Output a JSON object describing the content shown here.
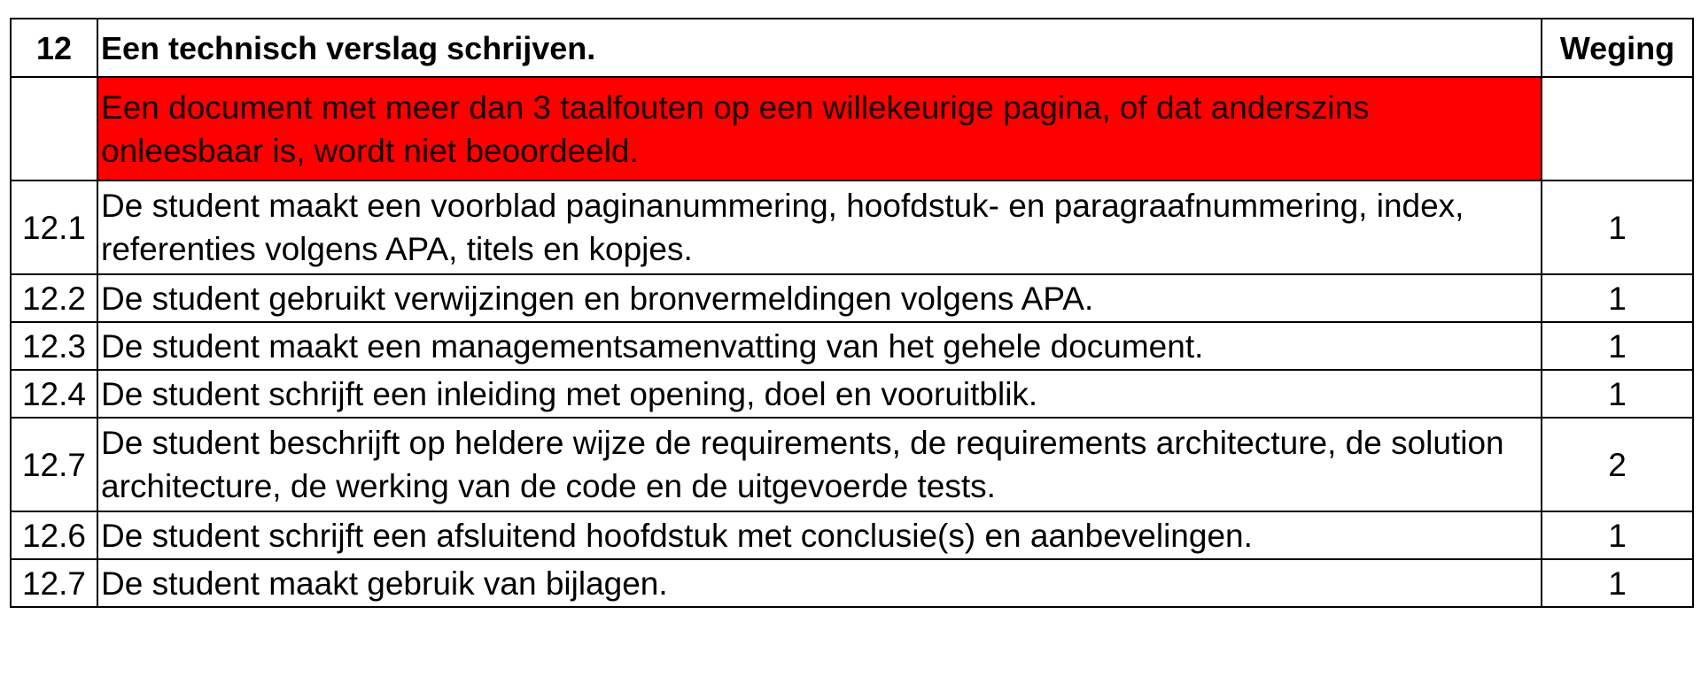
{
  "header": {
    "number": "12",
    "title": "Een technisch verslag schrijven.",
    "weight_label": "Weging"
  },
  "warning": {
    "text": "Een document met meer dan 3 taalfouten op een willekeurige pagina, of dat anderszins onleesbaar is, wordt niet beoordeeld.",
    "color": "#ff0000"
  },
  "rows": [
    {
      "number": "12.1",
      "text": "De student maakt een voorblad paginanummering, hoofdstuk- en paragraafnummering, index, referenties volgens APA, titels en kopjes.",
      "weight": "1"
    },
    {
      "number": "12.2",
      "text": "De student gebruikt verwijzingen en bronvermeldingen volgens APA.",
      "weight": "1"
    },
    {
      "number": "12.3",
      "text": "De student maakt een managementsamenvatting van het gehele document.",
      "weight": "1"
    },
    {
      "number": "12.4",
      "text": "De student schrijft een inleiding met opening, doel en vooruitblik.",
      "weight": "1"
    },
    {
      "number": "12.7",
      "text": "De student beschrijft op heldere wijze de requirements, de requirements architecture, de solution architecture, de werking van de code en de uitgevoerde tests.",
      "weight": "2"
    },
    {
      "number": "12.6",
      "text": "De student schrijft een afsluitend hoofdstuk met conclusie(s) en aanbevelingen.",
      "weight": "1"
    },
    {
      "number": "12.7",
      "text": "De student maakt gebruik van bijlagen.",
      "weight": "1"
    }
  ]
}
